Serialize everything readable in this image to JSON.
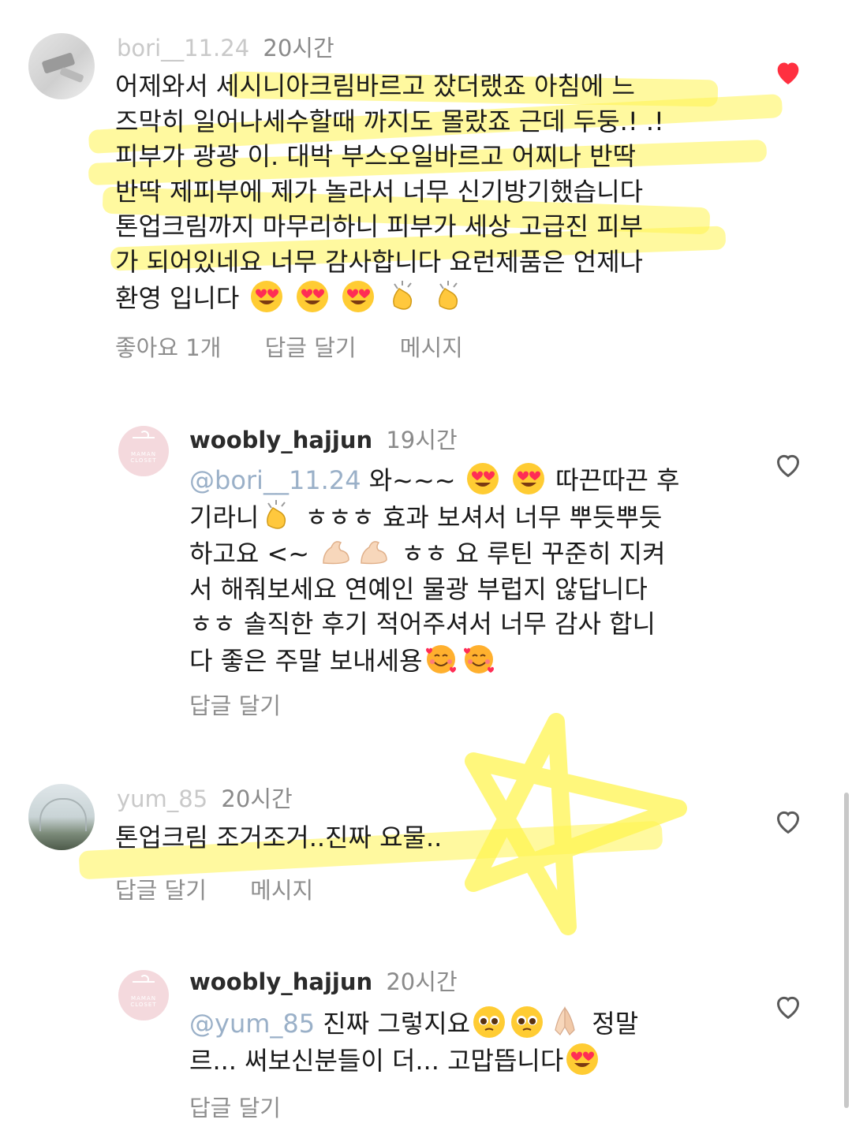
{
  "comments": [
    {
      "username": "bori__11.24",
      "time": "20시간",
      "text": [
        "어제와서  세시니아크림바르고 잤더랬죠 아침에  느",
        "즈막히 일어나세수할때 까지도 몰랐죠 근데 두둥.! .!",
        "피부가 광광 이.  대박  부스오일바르고 어찌나 반딱",
        "반딱 제피부에 제가 놀라서 너무 신기방기했습니다",
        "톤업크림까지 마무리하니 피부가 세상 고급진 피부",
        "가 되어있네요 너무 감사합니다 요런제품은 언제나",
        "환영  입니다"
      ],
      "likes_label": "좋아요 1개",
      "reply_label": "답글 달기",
      "message_label": "메시지",
      "liked": true
    },
    {
      "username": "woobly_hajjun",
      "time": "19시간",
      "mention": "@bori__11.24",
      "text_first": " 와~~~",
      "text_first_tail": " 따끈따끈 후",
      "text": [
        "기라니",
        " ㅎㅎㅎ 효과 보셔서 너무 뿌듯뿌듯",
        "하고요 <~ ",
        " ㅎㅎ 요 루틴 꾸준히 지켜",
        "서 해줘보세요 연예인 물광 부럽지 않답니다",
        "ㅎㅎ 솔직한 후기 적어주셔서 너무 감사 합니",
        "다 좋은 주말 보내세용"
      ],
      "reply_label": "답글 달기",
      "avatar_brand": "MAMAN CLOSET"
    },
    {
      "username": "yum_85",
      "time": "20시간",
      "text": "톤업크림 조거조거..진짜 요물..",
      "reply_label": "답글 달기",
      "message_label": "메시지"
    },
    {
      "username": "woobly_hajjun",
      "time": "20시간",
      "mention": "@yum_85",
      "text_first": " 진짜 그렇지요",
      "text_first_tail": " 정말",
      "text_second": "르... 써보신분들이 더... 고맙뜹니다",
      "reply_label": "답글 달기",
      "avatar_brand": "MAMAN CLOSET"
    }
  ],
  "colors": {
    "like_red": "#ff3040",
    "highlight": "#fff450",
    "text": "#1a1a1a",
    "secondary": "#8e8e8e"
  }
}
